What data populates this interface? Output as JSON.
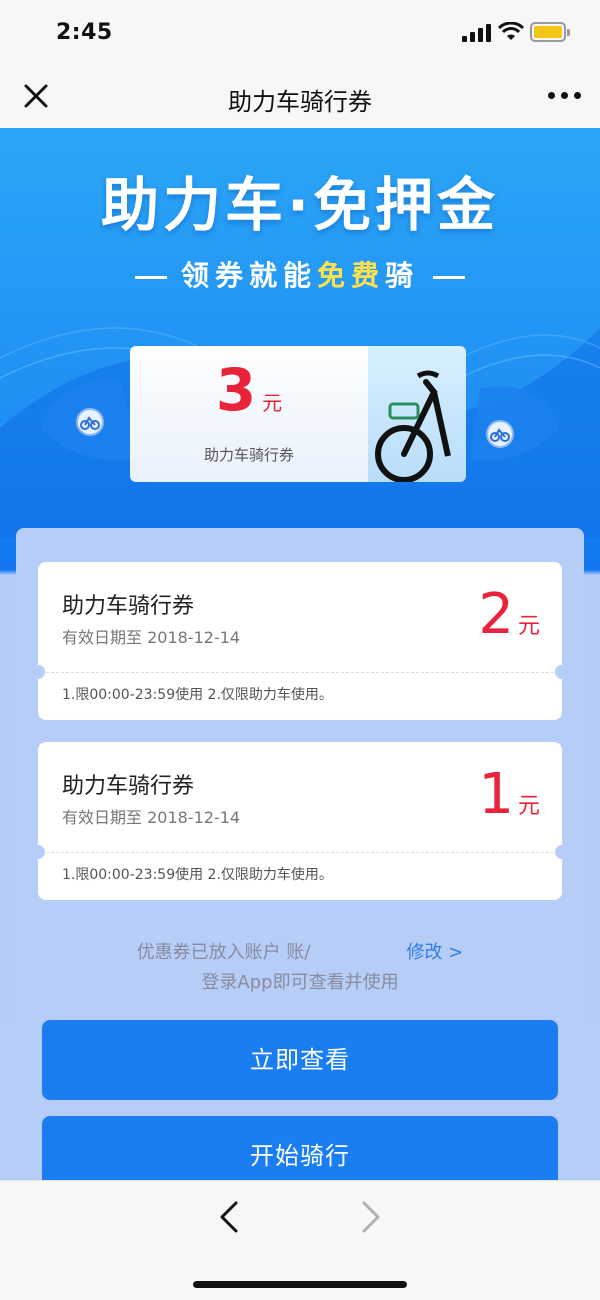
{
  "status_bar": {
    "time": "2:45"
  },
  "nav": {
    "title": "助力车骑行券"
  },
  "hero": {
    "title": "助力车·免押金",
    "subtitle_part1": "领券就能",
    "subtitle_highlight": "免费",
    "subtitle_part2": "骑",
    "ticket_amount": "3",
    "ticket_unit": "元",
    "ticket_label": "助力车骑行券"
  },
  "coupons": [
    {
      "name": "助力车骑行券",
      "expiry": "有效日期至 2018-12-14",
      "amount": "2",
      "unit": "元",
      "rules": "1.限00:00-23:59使用 2.仅限助力车使用。"
    },
    {
      "name": "助力车骑行券",
      "expiry": "有效日期至 2018-12-14",
      "amount": "1",
      "unit": "元",
      "rules": "1.限00:00-23:59使用 2.仅限助力车使用。"
    }
  ],
  "account": {
    "text": "优惠券已放入账户  账/",
    "edit_label": "修改 >",
    "login_hint": "登录App即可查看并使用"
  },
  "buttons": {
    "view_now": "立即查看",
    "start_ride": "开始骑行"
  },
  "colors": {
    "accent": "#1a7df2",
    "amount": "#e8233a",
    "highlight": "#ffe14d"
  }
}
